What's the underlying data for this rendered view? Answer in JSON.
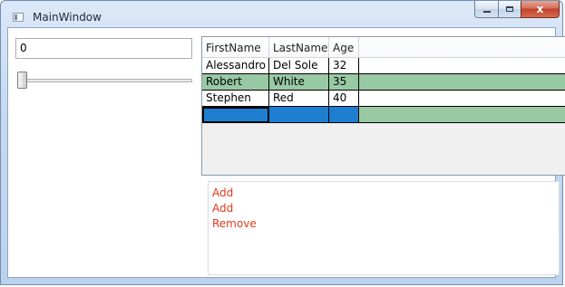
{
  "window": {
    "title": "MainWindow",
    "minimize_glyph": "minimize-icon",
    "maximize_glyph": "maximize-icon",
    "close_glyph": "x"
  },
  "textbox": {
    "value": "0"
  },
  "slider": {
    "value_fraction": 0.0
  },
  "grid": {
    "columns": [
      "FirstName",
      "LastName",
      "Age"
    ],
    "rows": [
      {
        "first": "Alessandro",
        "last": "Del Sole",
        "age": "32",
        "state": "normal"
      },
      {
        "first": "Robert",
        "last": "White",
        "age": "35",
        "state": "alternate"
      },
      {
        "first": "Stephen",
        "last": "Red",
        "age": "40",
        "state": "normal"
      },
      {
        "first": "",
        "last": "",
        "age": "",
        "state": "new-row-selected"
      }
    ],
    "colors": {
      "alternate_row": "#98c9a3",
      "selected_row": "#1e7ed0"
    }
  },
  "log": {
    "items": [
      "Add",
      "Add",
      "Remove"
    ],
    "text_color": "#e03a1c"
  }
}
